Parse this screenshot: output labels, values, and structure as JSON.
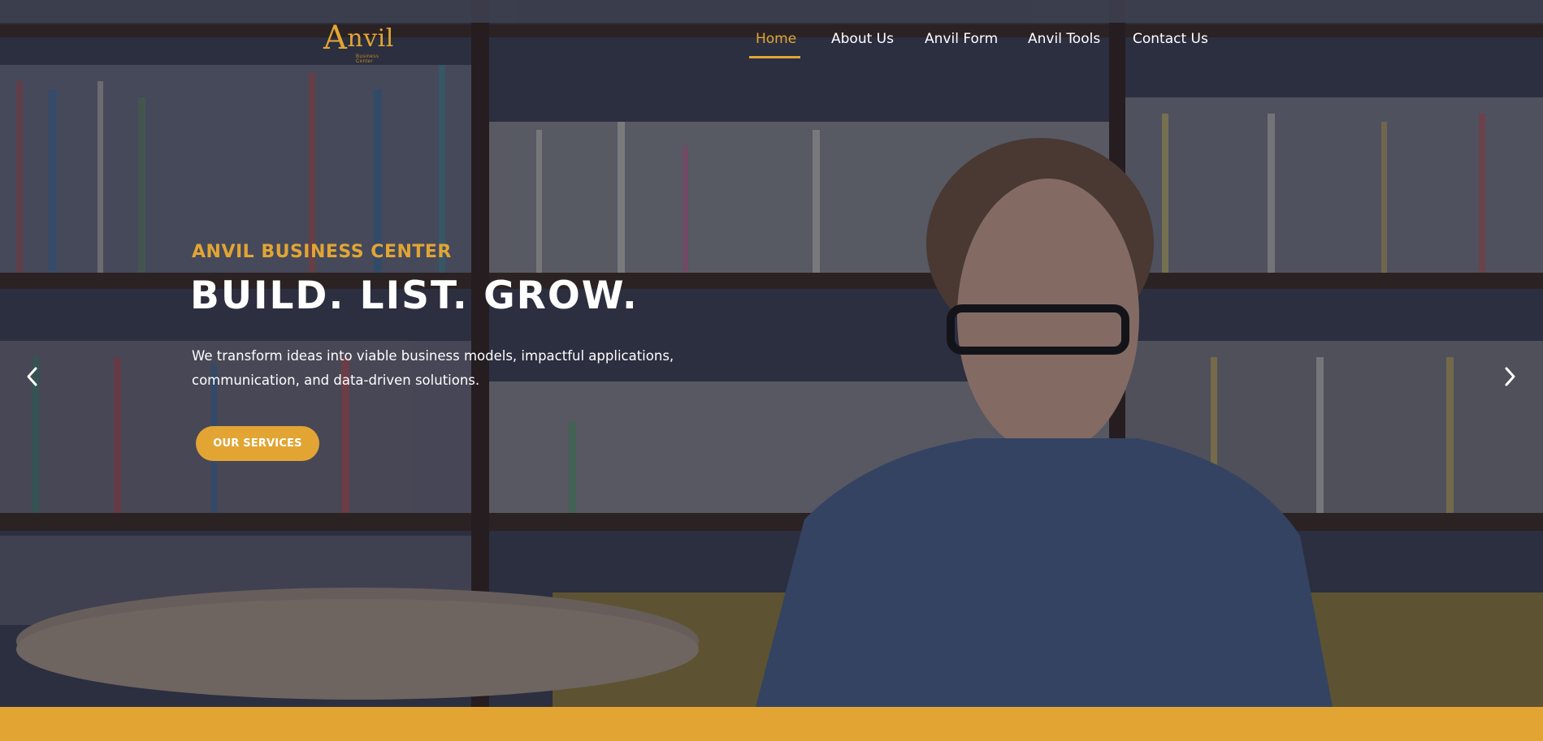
{
  "brand": {
    "logo_text": "Anvil",
    "logo_tagline": "Business Center",
    "accent_color": "#e2a534"
  },
  "nav": {
    "items": [
      {
        "label": "Home",
        "active": true
      },
      {
        "label": "About Us",
        "active": false
      },
      {
        "label": "Anvil Form",
        "active": false
      },
      {
        "label": "Anvil Tools",
        "active": false
      },
      {
        "label": "Contact Us",
        "active": false
      }
    ]
  },
  "hero": {
    "subtitle": "ANVIL BUSINESS CENTER",
    "headline": "BUILD. LIST. GROW.",
    "description": "We transform ideas into viable business models, impactful applications, communication, and data-driven solutions.",
    "cta_label": "OUR SERVICES",
    "background_image": "man-reading-in-library-photo"
  },
  "carousel": {
    "prev_icon": "chevron-left-icon",
    "next_icon": "chevron-right-icon"
  }
}
